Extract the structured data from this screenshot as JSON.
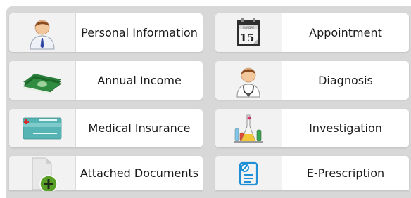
{
  "tiles": [
    {
      "label": "Personal Information",
      "icon": "person-icon"
    },
    {
      "label": "Appointment",
      "icon": "calendar-icon"
    },
    {
      "label": "Annual Income",
      "icon": "money-icon"
    },
    {
      "label": "Diagnosis",
      "icon": "doctor-icon"
    },
    {
      "label": "Medical Insurance",
      "icon": "insurance-card-icon"
    },
    {
      "label": "Investigation",
      "icon": "lab-flasks-icon"
    },
    {
      "label": "Attached Documents",
      "icon": "add-document-icon"
    },
    {
      "label": "E-Prescription",
      "icon": "prescription-icon"
    }
  ],
  "calendar": {
    "month": "SUNDAY",
    "day": "15"
  },
  "colors": {
    "panel_bg": "#d8d8d8",
    "tile_bg": "#ffffff",
    "icon_bg": "#f2f2f2",
    "add_green": "#5aa028",
    "prescription_blue": "#1f8fd6"
  }
}
